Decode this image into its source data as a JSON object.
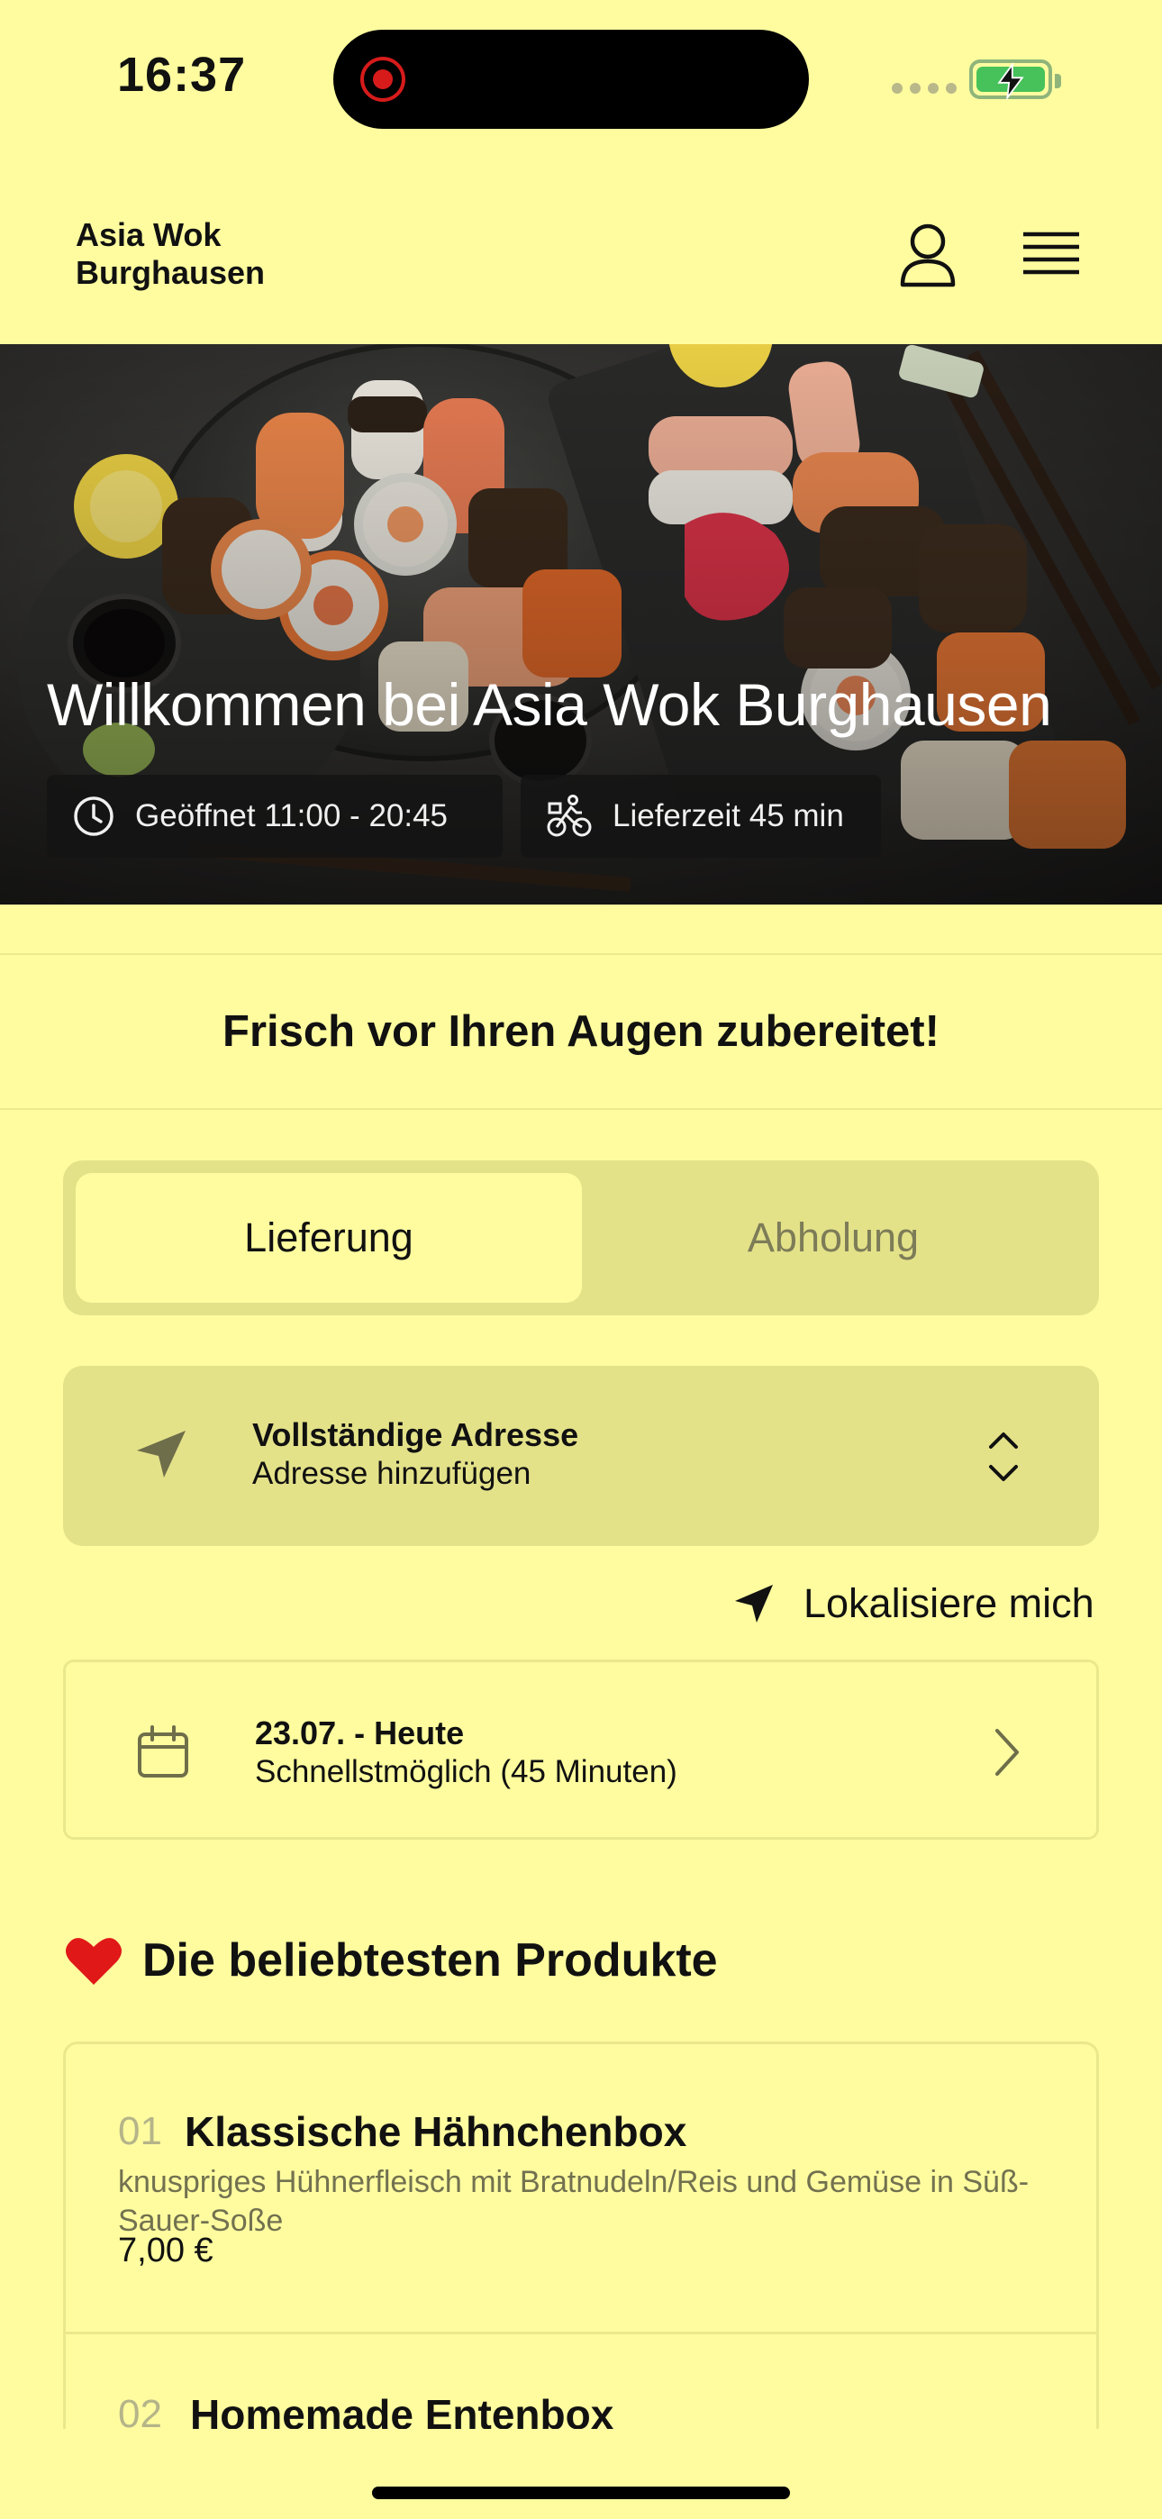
{
  "status_bar": {
    "time": "16:37"
  },
  "header": {
    "brand": "Asia Wok Burghausen"
  },
  "hero": {
    "title": "Willkommen bei Asia Wok Burghausen",
    "opening_hours": "Geöffnet 11:00 - 20:45",
    "delivery_time": "Lieferzeit 45 min"
  },
  "tagline": "Frisch vor Ihren Augen zubereitet!",
  "order_mode": {
    "options": [
      "Lieferung",
      "Abholung"
    ],
    "selected": "Lieferung"
  },
  "address": {
    "title": "Vollständige Adresse",
    "subtitle": "Adresse hinzufügen"
  },
  "locate_label": "Lokalisiere mich",
  "schedule": {
    "date": "23.07. - Heute",
    "time": "Schnellstmöglich (45 Minuten)"
  },
  "popular": {
    "heading": "Die beliebtesten Produkte",
    "products": [
      {
        "number": "01",
        "name": "Klassische Hähnchenbox",
        "description": "knuspriges Hühnerfleisch mit Bratnudeln/Reis und Gemüse in Süß-Sauer-Soße",
        "price": "7,00 €"
      },
      {
        "number": "02",
        "name": "Homemade Entenbox"
      }
    ]
  },
  "colors": {
    "background": "#fefc9f",
    "panel": "#e4e289",
    "accent_red": "#e01818"
  }
}
